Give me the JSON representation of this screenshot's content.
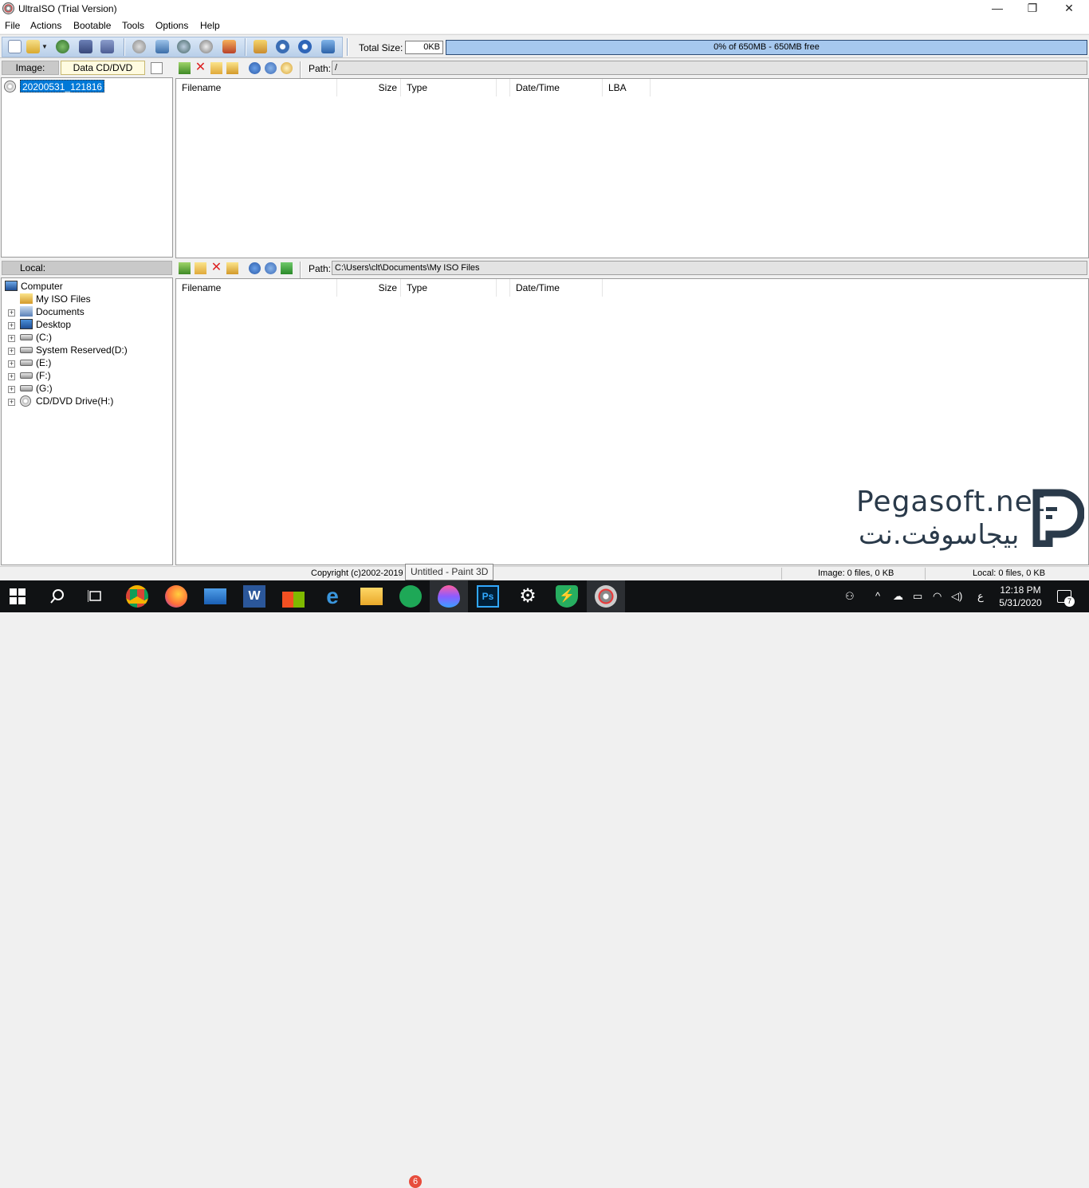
{
  "window": {
    "title": "UltraISO (Trial Version)",
    "controls": {
      "minimize": "—",
      "restore": "❐",
      "close": "✕"
    }
  },
  "menubar": {
    "items": [
      "File",
      "Actions",
      "Bootable",
      "Tools",
      "Options",
      "Help"
    ]
  },
  "toolbar": {
    "total_size_label": "Total Size:",
    "total_size_value": "0KB",
    "capacity_text": "0% of 650MB - 650MB free",
    "capacity_percent": 0,
    "icons": [
      "new-icon",
      "open-icon",
      "open-dropdown-icon",
      "reopen-icon",
      "save-icon",
      "save-as-icon",
      "make-cd-image-icon",
      "mount-icon",
      "compress-icon",
      "burn-icon",
      "virtual-drive-icon",
      "options-icon",
      "info-icon",
      "help-icon",
      "exit-icon"
    ]
  },
  "image_panel": {
    "label": "Image:",
    "type_value": "Data CD/DVD",
    "tree_root": "20200531_121816",
    "path_label": "Path:",
    "path_value": "/",
    "columns": [
      "Filename",
      "Size",
      "Type",
      "Date/Time",
      "LBA"
    ]
  },
  "local_panel": {
    "label": "Local:",
    "path_label": "Path:",
    "path_value": "C:\\Users\\clt\\Documents\\My ISO Files",
    "columns": [
      "Filename",
      "Size",
      "Type",
      "Date/Time"
    ],
    "tree": [
      {
        "label": "Computer",
        "icon": "computer-icon"
      },
      {
        "label": "My ISO Files",
        "icon": "folder-icon"
      },
      {
        "label": "Documents",
        "icon": "documents-icon"
      },
      {
        "label": "Desktop",
        "icon": "desktop-icon"
      },
      {
        "label": "(C:)",
        "icon": "drive-icon"
      },
      {
        "label": "System Reserved(D:)",
        "icon": "drive-icon"
      },
      {
        "label": "(E:)",
        "icon": "drive-icon"
      },
      {
        "label": "(F:)",
        "icon": "drive-icon"
      },
      {
        "label": "(G:)",
        "icon": "drive-icon"
      },
      {
        "label": "CD/DVD Drive(H:)",
        "icon": "cd-drive-icon"
      }
    ]
  },
  "statusbar": {
    "copyright": "Copyright (c)2002-2019 E",
    "image_status": "Image: 0 files, 0 KB",
    "local_status": "Local: 0 files, 0 KB",
    "tooltip": "Untitled - Paint 3D"
  },
  "watermark": {
    "english": "Pegasoft.net",
    "arabic": "بيجاسوفت.نت"
  },
  "taskbar": {
    "apps": [
      "start-icon",
      "search-icon",
      "task-view-icon",
      "chrome-icon",
      "firefox-icon",
      "mail-icon",
      "word-icon",
      "store-icon",
      "edge-icon",
      "explorer-icon",
      "whatsapp-icon",
      "paint3d-icon",
      "photoshop-icon",
      "settings-icon",
      "kaspersky-icon",
      "ultraiso-icon"
    ],
    "whatsapp_badge": "6",
    "tray_language": "ع",
    "time": "12:18 PM",
    "date": "5/31/2020",
    "notification_count": "7"
  },
  "colors": {
    "capacity_bar": "#a6c8ee",
    "selection": "#0078d7",
    "taskbar": "#101214"
  }
}
